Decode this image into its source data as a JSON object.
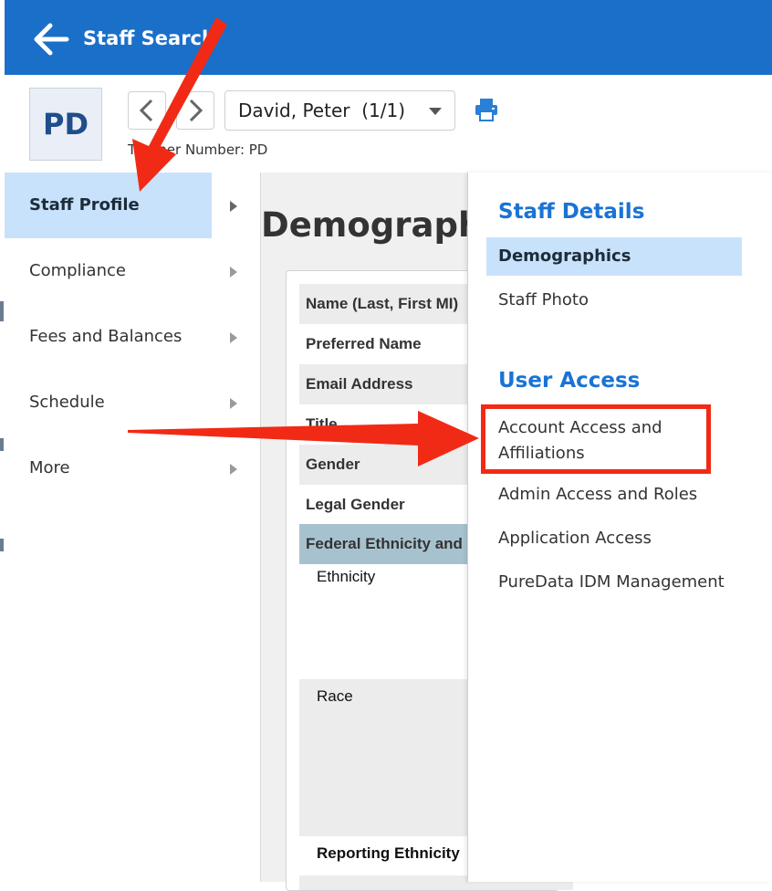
{
  "header": {
    "title": "Staff Search",
    "back_icon": "back-arrow-icon",
    "color": "#1a6fc9"
  },
  "profile": {
    "initials": "PD",
    "selected_staff": "David, Peter",
    "record_count": "(1/1)",
    "teacher_number_label": "Teacher Number: PD",
    "prev_icon": "chevron-left-icon",
    "next_icon": "chevron-right-icon",
    "print_icon": "printer-icon"
  },
  "sidebar": {
    "items": [
      {
        "label": "Staff Profile",
        "active": true
      },
      {
        "label": "Compliance",
        "active": false
      },
      {
        "label": "Fees and Balances",
        "active": false
      },
      {
        "label": "Schedule",
        "active": false
      },
      {
        "label": "More",
        "active": false
      }
    ]
  },
  "main": {
    "title": "Demographics",
    "fields": [
      "Name (Last, First MI)",
      "Preferred Name",
      "Email Address",
      "Title",
      "Gender",
      "Legal Gender"
    ],
    "section": "Federal Ethnicity and Race",
    "sub_fields": [
      "Ethnicity",
      "Race",
      "Reporting Ethnicity"
    ]
  },
  "flyout": {
    "staff_details_heading": "Staff Details",
    "staff_details_items": [
      {
        "label": "Demographics",
        "active": true
      },
      {
        "label": "Staff Photo",
        "active": false
      }
    ],
    "user_access_heading": "User Access",
    "user_access_items": [
      {
        "label": "Account Access and Affiliations"
      },
      {
        "label": "Admin Access and Roles"
      },
      {
        "label": "Application Access"
      },
      {
        "label": "PureData IDM Management"
      }
    ],
    "accent_color": "#1a73d4"
  },
  "annotations": {
    "color": "#f12a16"
  }
}
